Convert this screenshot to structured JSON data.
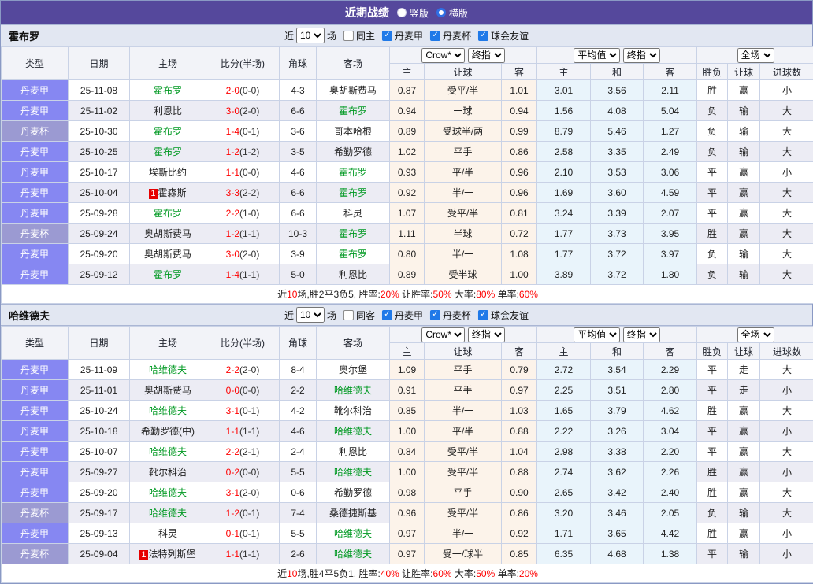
{
  "title_bar": {
    "title": "近期战绩",
    "vertical_label": "竖版",
    "horizontal_label": "横版",
    "vertical_checked": false,
    "horizontal_checked": true
  },
  "filter_labels": {
    "near": "近",
    "unit": "场"
  },
  "columns": {
    "type": "类型",
    "date": "日期",
    "home": "主场",
    "score": "比分(半场)",
    "corner": "角球",
    "away": "客场",
    "selects": {
      "crow": "Crow*",
      "final1": "终指",
      "avg": "平均值",
      "final2": "终指",
      "full": "全场"
    },
    "sub": [
      "主",
      "让球",
      "客",
      "主",
      "和",
      "客",
      "胜负",
      "让球",
      "进球数"
    ]
  },
  "colors": {
    "accent_purple": "#55489c",
    "league_jia": "#8687f2",
    "league_bei": "#9b9ad2",
    "focus_team_green": "#009922",
    "score_red": "#ff0000",
    "win_red": "#e60000",
    "draw_green": "#008822",
    "lose_blue": "#1414cc"
  },
  "result_color_map": {
    "胜": "r",
    "赢": "r",
    "大": "r",
    "平": "g",
    "走": "g",
    "负": "b",
    "输": "b",
    "小": "b"
  },
  "sections": [
    {
      "team": "霍布罗",
      "near_count": "10",
      "filters": [
        {
          "label": "同主",
          "checked": false
        },
        {
          "label": "丹麦甲",
          "checked": true
        },
        {
          "label": "丹麦杯",
          "checked": true
        },
        {
          "label": "球会友谊",
          "checked": true
        }
      ],
      "rows": [
        {
          "league": "丹麦甲",
          "lt": "jia",
          "date": "25-11-08",
          "home": "霍布罗",
          "hf": true,
          "hb": "",
          "score": "2-0",
          "half": "(0-0)",
          "corner": "4-3",
          "away": "奥胡斯费马",
          "af": false,
          "crow": [
            "0.87",
            "受平/半",
            "1.01"
          ],
          "avg": [
            "3.01",
            "3.56",
            "2.11"
          ],
          "res": [
            "胜",
            "赢",
            "小"
          ]
        },
        {
          "league": "丹麦甲",
          "lt": "jia",
          "date": "25-11-02",
          "home": "利恩比",
          "hf": false,
          "hb": "",
          "score": "3-0",
          "half": "(2-0)",
          "corner": "6-6",
          "away": "霍布罗",
          "af": true,
          "crow": [
            "0.94",
            "一球",
            "0.94"
          ],
          "avg": [
            "1.56",
            "4.08",
            "5.04"
          ],
          "res": [
            "负",
            "输",
            "大"
          ]
        },
        {
          "league": "丹麦杯",
          "lt": "bei",
          "date": "25-10-30",
          "home": "霍布罗",
          "hf": true,
          "hb": "",
          "score": "1-4",
          "half": "(0-1)",
          "corner": "3-6",
          "away": "哥本哈根",
          "af": false,
          "crow": [
            "0.89",
            "受球半/两",
            "0.99"
          ],
          "avg": [
            "8.79",
            "5.46",
            "1.27"
          ],
          "res": [
            "负",
            "输",
            "大"
          ]
        },
        {
          "league": "丹麦甲",
          "lt": "jia",
          "date": "25-10-25",
          "home": "霍布罗",
          "hf": true,
          "hb": "",
          "score": "1-2",
          "half": "(1-2)",
          "corner": "3-5",
          "away": "希勤罗德",
          "af": false,
          "crow": [
            "1.02",
            "平手",
            "0.86"
          ],
          "avg": [
            "2.58",
            "3.35",
            "2.49"
          ],
          "res": [
            "负",
            "输",
            "大"
          ]
        },
        {
          "league": "丹麦甲",
          "lt": "jia",
          "date": "25-10-17",
          "home": "埃斯比约",
          "hf": false,
          "hb": "",
          "score": "1-1",
          "half": "(0-0)",
          "corner": "4-6",
          "away": "霍布罗",
          "af": true,
          "crow": [
            "0.93",
            "平/半",
            "0.96"
          ],
          "avg": [
            "2.10",
            "3.53",
            "3.06"
          ],
          "res": [
            "平",
            "赢",
            "小"
          ]
        },
        {
          "league": "丹麦甲",
          "lt": "jia",
          "date": "25-10-04",
          "home": "霍森斯",
          "hf": false,
          "hb": "1",
          "score": "3-3",
          "half": "(2-2)",
          "corner": "6-6",
          "away": "霍布罗",
          "af": true,
          "crow": [
            "0.92",
            "半/一",
            "0.96"
          ],
          "avg": [
            "1.69",
            "3.60",
            "4.59"
          ],
          "res": [
            "平",
            "赢",
            "大"
          ]
        },
        {
          "league": "丹麦甲",
          "lt": "jia",
          "date": "25-09-28",
          "home": "霍布罗",
          "hf": true,
          "hb": "",
          "score": "2-2",
          "half": "(1-0)",
          "corner": "6-6",
          "away": "科灵",
          "af": false,
          "crow": [
            "1.07",
            "受平/半",
            "0.81"
          ],
          "avg": [
            "3.24",
            "3.39",
            "2.07"
          ],
          "res": [
            "平",
            "赢",
            "大"
          ]
        },
        {
          "league": "丹麦杯",
          "lt": "bei",
          "date": "25-09-24",
          "home": "奥胡斯费马",
          "hf": false,
          "hb": "",
          "score": "1-2",
          "half": "(1-1)",
          "corner": "10-3",
          "away": "霍布罗",
          "af": true,
          "crow": [
            "1.11",
            "半球",
            "0.72"
          ],
          "avg": [
            "1.77",
            "3.73",
            "3.95"
          ],
          "res": [
            "胜",
            "赢",
            "大"
          ]
        },
        {
          "league": "丹麦甲",
          "lt": "jia",
          "date": "25-09-20",
          "home": "奥胡斯费马",
          "hf": false,
          "hb": "",
          "score": "3-0",
          "half": "(2-0)",
          "corner": "3-9",
          "away": "霍布罗",
          "af": true,
          "crow": [
            "0.80",
            "半/一",
            "1.08"
          ],
          "avg": [
            "1.77",
            "3.72",
            "3.97"
          ],
          "res": [
            "负",
            "输",
            "大"
          ]
        },
        {
          "league": "丹麦甲",
          "lt": "jia",
          "date": "25-09-12",
          "home": "霍布罗",
          "hf": true,
          "hb": "",
          "score": "1-4",
          "half": "(1-1)",
          "corner": "5-0",
          "away": "利恩比",
          "af": false,
          "crow": [
            "0.89",
            "受半球",
            "1.00"
          ],
          "avg": [
            "3.89",
            "3.72",
            "1.80"
          ],
          "res": [
            "负",
            "输",
            "大"
          ]
        }
      ],
      "summary": [
        {
          "t": "近"
        },
        {
          "t": "10",
          "red": true
        },
        {
          "t": "场,胜2平3负5, 胜率:"
        },
        {
          "t": "20%",
          "red": true
        },
        {
          "t": " 让胜率:"
        },
        {
          "t": "50%",
          "red": true
        },
        {
          "t": " 大率:"
        },
        {
          "t": "80%",
          "red": true
        },
        {
          "t": " 单率:"
        },
        {
          "t": "60%",
          "red": true
        }
      ]
    },
    {
      "team": "哈维德夫",
      "near_count": "10",
      "filters": [
        {
          "label": "同客",
          "checked": false
        },
        {
          "label": "丹麦甲",
          "checked": true
        },
        {
          "label": "丹麦杯",
          "checked": true
        },
        {
          "label": "球会友谊",
          "checked": true
        }
      ],
      "rows": [
        {
          "league": "丹麦甲",
          "lt": "jia",
          "date": "25-11-09",
          "home": "哈维德夫",
          "hf": true,
          "hb": "",
          "score": "2-2",
          "half": "(2-0)",
          "corner": "8-4",
          "away": "奥尔堡",
          "af": false,
          "crow": [
            "1.09",
            "平手",
            "0.79"
          ],
          "avg": [
            "2.72",
            "3.54",
            "2.29"
          ],
          "res": [
            "平",
            "走",
            "大"
          ]
        },
        {
          "league": "丹麦甲",
          "lt": "jia",
          "date": "25-11-01",
          "home": "奥胡斯费马",
          "hf": false,
          "hb": "",
          "score": "0-0",
          "half": "(0-0)",
          "corner": "2-2",
          "away": "哈维德夫",
          "af": true,
          "crow": [
            "0.91",
            "平手",
            "0.97"
          ],
          "avg": [
            "2.25",
            "3.51",
            "2.80"
          ],
          "res": [
            "平",
            "走",
            "小"
          ]
        },
        {
          "league": "丹麦甲",
          "lt": "jia",
          "date": "25-10-24",
          "home": "哈维德夫",
          "hf": true,
          "hb": "",
          "score": "3-1",
          "half": "(0-1)",
          "corner": "4-2",
          "away": "靴尔科治",
          "af": false,
          "crow": [
            "0.85",
            "半/一",
            "1.03"
          ],
          "avg": [
            "1.65",
            "3.79",
            "4.62"
          ],
          "res": [
            "胜",
            "赢",
            "大"
          ]
        },
        {
          "league": "丹麦甲",
          "lt": "jia",
          "date": "25-10-18",
          "home": "希勤罗德(中)",
          "hf": false,
          "hb": "",
          "score": "1-1",
          "half": "(1-1)",
          "corner": "4-6",
          "away": "哈维德夫",
          "af": true,
          "crow": [
            "1.00",
            "平/半",
            "0.88"
          ],
          "avg": [
            "2.22",
            "3.26",
            "3.04"
          ],
          "res": [
            "平",
            "赢",
            "小"
          ]
        },
        {
          "league": "丹麦甲",
          "lt": "jia",
          "date": "25-10-07",
          "home": "哈维德夫",
          "hf": true,
          "hb": "",
          "score": "2-2",
          "half": "(2-1)",
          "corner": "2-4",
          "away": "利恩比",
          "af": false,
          "crow": [
            "0.84",
            "受平/半",
            "1.04"
          ],
          "avg": [
            "2.98",
            "3.38",
            "2.20"
          ],
          "res": [
            "平",
            "赢",
            "大"
          ]
        },
        {
          "league": "丹麦甲",
          "lt": "jia",
          "date": "25-09-27",
          "home": "靴尔科治",
          "hf": false,
          "hb": "",
          "score": "0-2",
          "half": "(0-0)",
          "corner": "5-5",
          "away": "哈维德夫",
          "af": true,
          "crow": [
            "1.00",
            "受平/半",
            "0.88"
          ],
          "avg": [
            "2.74",
            "3.62",
            "2.26"
          ],
          "res": [
            "胜",
            "赢",
            "小"
          ]
        },
        {
          "league": "丹麦甲",
          "lt": "jia",
          "date": "25-09-20",
          "home": "哈维德夫",
          "hf": true,
          "hb": "",
          "score": "3-1",
          "half": "(2-0)",
          "corner": "0-6",
          "away": "希勤罗德",
          "af": false,
          "crow": [
            "0.98",
            "平手",
            "0.90"
          ],
          "avg": [
            "2.65",
            "3.42",
            "2.40"
          ],
          "res": [
            "胜",
            "赢",
            "大"
          ]
        },
        {
          "league": "丹麦杯",
          "lt": "bei",
          "date": "25-09-17",
          "home": "哈维德夫",
          "hf": true,
          "hb": "",
          "score": "1-2",
          "half": "(0-1)",
          "corner": "7-4",
          "away": "桑德捷斯基",
          "af": false,
          "crow": [
            "0.96",
            "受平/半",
            "0.86"
          ],
          "avg": [
            "3.20",
            "3.46",
            "2.05"
          ],
          "res": [
            "负",
            "输",
            "大"
          ]
        },
        {
          "league": "丹麦甲",
          "lt": "jia",
          "date": "25-09-13",
          "home": "科灵",
          "hf": false,
          "hb": "",
          "score": "0-1",
          "half": "(0-1)",
          "corner": "5-5",
          "away": "哈维德夫",
          "af": true,
          "crow": [
            "0.97",
            "半/一",
            "0.92"
          ],
          "avg": [
            "1.71",
            "3.65",
            "4.42"
          ],
          "res": [
            "胜",
            "赢",
            "小"
          ]
        },
        {
          "league": "丹麦杯",
          "lt": "bei",
          "date": "25-09-04",
          "home": "法特列斯堡",
          "hf": false,
          "hb": "1",
          "score": "1-1",
          "half": "(1-1)",
          "corner": "2-6",
          "away": "哈维德夫",
          "af": true,
          "crow": [
            "0.97",
            "受一/球半",
            "0.85"
          ],
          "avg": [
            "6.35",
            "4.68",
            "1.38"
          ],
          "res": [
            "平",
            "输",
            "小"
          ]
        }
      ],
      "summary": [
        {
          "t": "近"
        },
        {
          "t": "10",
          "red": true
        },
        {
          "t": "场,胜4平5负1, 胜率:"
        },
        {
          "t": "40%",
          "red": true
        },
        {
          "t": " 让胜率:"
        },
        {
          "t": "60%",
          "red": true
        },
        {
          "t": " 大率:"
        },
        {
          "t": "50%",
          "red": true
        },
        {
          "t": " 单率:"
        },
        {
          "t": "20%",
          "red": true
        }
      ]
    }
  ]
}
